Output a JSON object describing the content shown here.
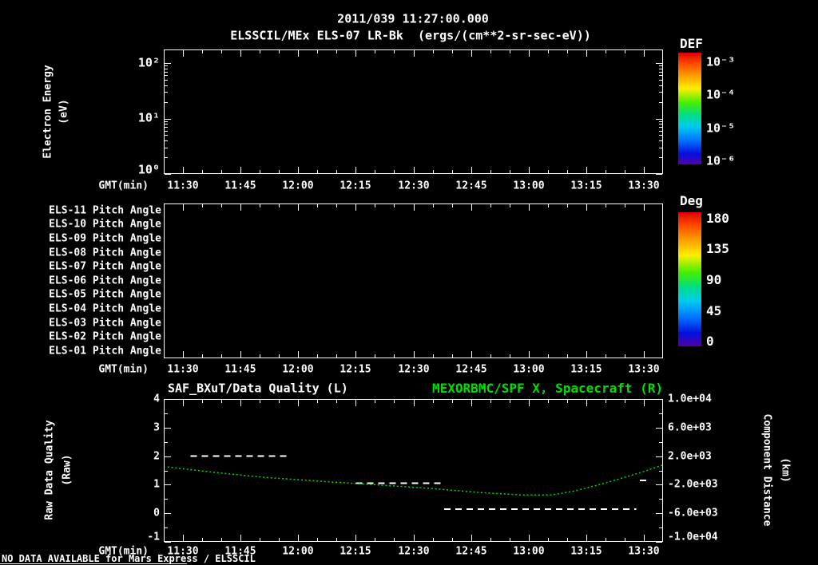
{
  "header": {
    "timestamp": "2011/039 11:27:00.000",
    "title": "ELSSCIL/MEx ELS-07 LR-Bk  (ergs/(cm**2-sr-sec-eV))"
  },
  "colors": {
    "background": "#000000",
    "foreground": "#ffffff",
    "green": "#00dd00"
  },
  "time_axis": {
    "label": "GMT(min)",
    "ticks": [
      "11:30",
      "11:45",
      "12:00",
      "12:15",
      "12:30",
      "12:45",
      "13:00",
      "13:15",
      "13:30"
    ]
  },
  "panel1": {
    "ylabel_line1": "Electron Energy",
    "ylabel_line2": "(eV)",
    "ytick_labels": [
      "10²",
      "10¹",
      "10⁰"
    ],
    "colorbar": {
      "title": "DEF",
      "tick_labels": [
        "10⁻³",
        "10⁻⁴",
        "10⁻⁵",
        "10⁻⁶"
      ]
    }
  },
  "panel2": {
    "row_labels": [
      "ELS-11 Pitch Angle",
      "ELS-10 Pitch Angle",
      "ELS-09 Pitch Angle",
      "ELS-08 Pitch Angle",
      "ELS-07 Pitch Angle",
      "ELS-06 Pitch Angle",
      "ELS-05 Pitch Angle",
      "ELS-04 Pitch Angle",
      "ELS-03 Pitch Angle",
      "ELS-02 Pitch Angle",
      "ELS-01 Pitch Angle"
    ],
    "colorbar": {
      "title": "Deg",
      "tick_labels": [
        "180",
        "135",
        "90",
        "45",
        "0"
      ]
    }
  },
  "panel3": {
    "title_left": "SAF_BXuT/Data Quality (L)",
    "title_right": "MEXORBMC/SPF X, Spacecraft (R)",
    "ylabel_left_line1": "Raw Data Quality",
    "ylabel_left_line2": "(Raw)",
    "ylabel_right_line1": "Component Distance",
    "ylabel_right_line2": "(km)",
    "ytick_labels_left": [
      "4",
      "3",
      "2",
      "1",
      "0",
      "-1"
    ],
    "ytick_labels_right": [
      "1.0e+04",
      "6.0e+03",
      "2.0e+03",
      "-2.0e+03",
      "-6.0e+03",
      "-1.0e+04"
    ]
  },
  "footer": {
    "no_data_text": "NO DATA AVAILABLE for Mars Express / ELSSCIL"
  },
  "chart_data": [
    {
      "type": "heatmap",
      "title": "ELSSCIL/MEx ELS-07 LR-Bk electron energy spectrogram",
      "xlabel": "GMT(min)",
      "x_ticks": [
        "11:30",
        "11:45",
        "12:00",
        "12:15",
        "12:30",
        "12:45",
        "13:00",
        "13:15",
        "13:30"
      ],
      "ylabel": "Electron Energy (eV)",
      "y_scale": "log",
      "ylim": [
        1,
        178
      ],
      "colorbar": {
        "title": "DEF",
        "units": "ergs/(cm**2-sr-sec-eV)",
        "scale": "log",
        "range": [
          1e-06,
          0.001
        ]
      },
      "values": [],
      "note": "panel empty - no data plotted"
    },
    {
      "type": "heatmap",
      "title": "ELS pitch angle per anode",
      "xlabel": "GMT(min)",
      "x_ticks": [
        "11:30",
        "11:45",
        "12:00",
        "12:15",
        "12:30",
        "12:45",
        "13:00",
        "13:15",
        "13:30"
      ],
      "rows": [
        "ELS-11",
        "ELS-10",
        "ELS-09",
        "ELS-08",
        "ELS-07",
        "ELS-06",
        "ELS-05",
        "ELS-04",
        "ELS-03",
        "ELS-02",
        "ELS-01"
      ],
      "colorbar": {
        "title": "Deg",
        "range": [
          0,
          180
        ]
      },
      "values": [],
      "note": "panel empty - no data plotted"
    },
    {
      "type": "line",
      "title_left": "SAF_BXuT/Data Quality (L)",
      "title_right": "MEXORBMC/SPF X, Spacecraft (R)",
      "xlabel": "GMT(min)",
      "x_domain_minutes_after_1100": [
        25,
        155
      ],
      "ylim_left": [
        -1,
        4
      ],
      "ylim_right": [
        -10000,
        10000
      ],
      "series": [
        {
          "name": "SAF_BXuT/Data Quality",
          "axis": "left",
          "color": "#ffffff",
          "style": "dashed",
          "segments": [
            {
              "t_start": 32,
              "t_end": 58,
              "value": 2.0
            },
            {
              "t_start": 75,
              "t_end": 98,
              "value": 1.05
            },
            {
              "t_start": 98,
              "t_end": 148,
              "value": 0.15
            },
            {
              "t_start": 149,
              "t_end": 151.5,
              "value": 1.15
            }
          ]
        },
        {
          "name": "MEXORBMC/SPF X Spacecraft",
          "axis": "right",
          "color": "#00dd00",
          "style": "dotted",
          "t_minutes": [
            26,
            39,
            51,
            66,
            80,
            95,
            107,
            118,
            126,
            132,
            140,
            149,
            155
          ],
          "km": [
            480,
            -320,
            -960,
            -1520,
            -2000,
            -2540,
            -3080,
            -3430,
            -3430,
            -2880,
            -1760,
            -320,
            760
          ]
        }
      ]
    }
  ]
}
